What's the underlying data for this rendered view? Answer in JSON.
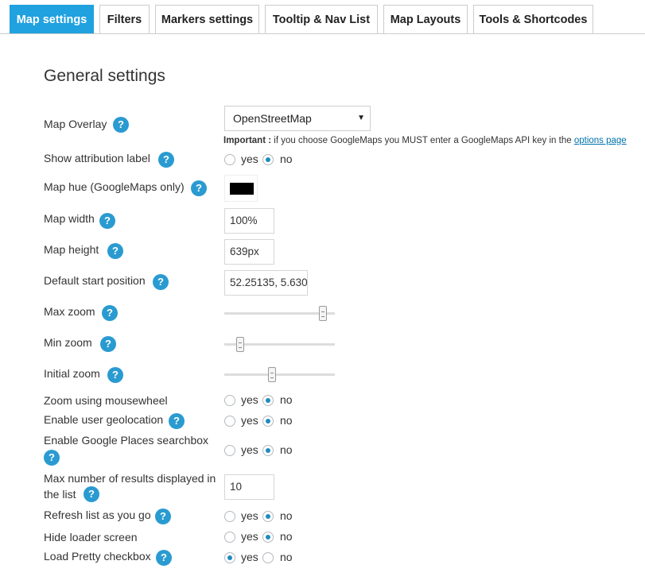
{
  "tabs": [
    {
      "label": "Map settings",
      "active": true
    },
    {
      "label": "Filters",
      "active": false
    },
    {
      "label": "Markers settings",
      "active": false
    },
    {
      "label": "Tooltip & Nav List",
      "active": false
    },
    {
      "label": "Map Layouts",
      "active": false
    },
    {
      "label": "Tools & Shortcodes",
      "active": false
    }
  ],
  "section_title": "General settings",
  "help_glyph": "?",
  "yes_label": "yes",
  "no_label": "no",
  "accent_color": "#20a1e0",
  "fields": {
    "map_overlay": {
      "label": "Map Overlay",
      "value": "OpenStreetMap"
    },
    "overlay_note": {
      "bold": "Important :",
      "text": " if you choose GoogleMaps you MUST enter a GoogleMaps API key in the ",
      "link": "options page"
    },
    "show_attribution": {
      "label": "Show attribution label",
      "selected": "no"
    },
    "map_hue": {
      "label": "Map hue (GoogleMaps only)",
      "color": "#000000"
    },
    "map_width": {
      "label": "Map width",
      "value": "100%"
    },
    "map_height": {
      "label": "Map height",
      "value": "639px"
    },
    "start_position": {
      "label": "Default start position",
      "value": "52.25135, 5.630"
    },
    "max_zoom": {
      "label": "Max zoom",
      "level_fraction": 0.92
    },
    "min_zoom": {
      "label": "Min zoom",
      "level_fraction": 0.12
    },
    "initial_zoom": {
      "label": "Initial zoom",
      "level_fraction": 0.43
    },
    "zoom_mousewheel": {
      "label": "Zoom using mousewheel",
      "selected": "no"
    },
    "user_geolocation": {
      "label": "Enable user geolocation",
      "selected": "no"
    },
    "places_searchbox": {
      "label": "Enable Google Places searchbox",
      "selected": "no"
    },
    "max_results": {
      "label": "Max number of results displayed in the list",
      "value": "10"
    },
    "refresh_list": {
      "label": "Refresh list as you go",
      "selected": "no"
    },
    "hide_loader": {
      "label": "Hide loader screen",
      "selected": "no"
    },
    "pretty_checkbox": {
      "label": "Load Pretty checkbox",
      "selected": "yes"
    }
  }
}
